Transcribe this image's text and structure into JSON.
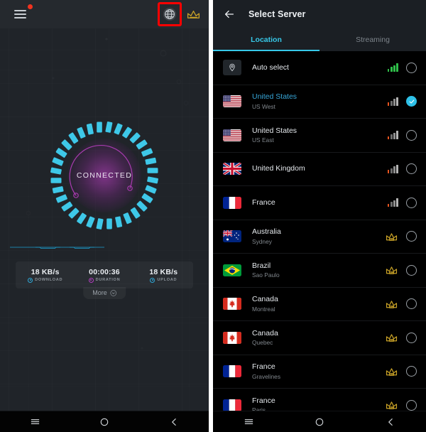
{
  "left_panel": {
    "topbar": {
      "menu_icon": "hamburger-menu-icon",
      "notification_dot": "red-dot-badge",
      "globe_icon": "globe-icon",
      "globe_highlight_color": "#ff0000",
      "crown_icon": "crown-icon"
    },
    "dial": {
      "status_label": "CONNECTED",
      "tick_color": "#3ec8e8",
      "ring_color": "#a93bb0",
      "tick_count": 32
    },
    "stats": [
      {
        "value": "18 KB/s",
        "label": "DOWNLOAD",
        "icon": "download-icon",
        "color": "#2ea8d8"
      },
      {
        "value": "00:00:36",
        "label": "DURATION",
        "icon": "clock-icon",
        "color": "#b23ec0"
      },
      {
        "value": "18 KB/s",
        "label": "UPLOAD",
        "icon": "upload-icon",
        "color": "#2ea8d8"
      }
    ],
    "more": {
      "label": "More",
      "icon": "chevron-down-circle-icon"
    },
    "navbar": [
      {
        "name": "recents-button",
        "icon": "menu-lines-icon"
      },
      {
        "name": "home-button",
        "icon": "circle-icon"
      },
      {
        "name": "back-button",
        "icon": "chevron-left-icon"
      }
    ]
  },
  "right_panel": {
    "header": {
      "back_icon": "back-arrow-icon",
      "title": "Select Server"
    },
    "tabs": [
      {
        "label": "Location",
        "active": true
      },
      {
        "label": "Streaming",
        "active": false
      }
    ],
    "accent_color": "#37c8e8",
    "servers": [
      {
        "name": "Auto select",
        "sub": "",
        "flag": "pin",
        "signal": "green4",
        "badge": "signal",
        "selected": false,
        "highlighted": false
      },
      {
        "name": "United States",
        "sub": "US West",
        "flag": "us",
        "signal": "orange1",
        "badge": "signal",
        "selected": true,
        "highlighted": true
      },
      {
        "name": "United States",
        "sub": "US East",
        "flag": "us",
        "signal": "orange1",
        "badge": "signal",
        "selected": false,
        "highlighted": false
      },
      {
        "name": "United Kingdom",
        "sub": "",
        "flag": "uk",
        "signal": "orange1",
        "badge": "signal",
        "selected": false,
        "highlighted": false
      },
      {
        "name": "France",
        "sub": "",
        "flag": "fr",
        "signal": "orange1",
        "badge": "signal",
        "selected": false,
        "highlighted": false
      },
      {
        "name": "Australia",
        "sub": "Sydney",
        "flag": "au",
        "signal": "",
        "badge": "pro",
        "selected": false,
        "highlighted": false
      },
      {
        "name": "Brazil",
        "sub": "Sao Paulo",
        "flag": "br",
        "signal": "",
        "badge": "pro",
        "selected": false,
        "highlighted": false
      },
      {
        "name": "Canada",
        "sub": "Montreal",
        "flag": "ca",
        "signal": "",
        "badge": "pro",
        "selected": false,
        "highlighted": false
      },
      {
        "name": "Canada",
        "sub": "Quebec",
        "flag": "ca",
        "signal": "",
        "badge": "pro",
        "selected": false,
        "highlighted": false
      },
      {
        "name": "France",
        "sub": "Gravelines",
        "flag": "fr",
        "signal": "",
        "badge": "pro",
        "selected": false,
        "highlighted": false
      },
      {
        "name": "France",
        "sub": "Paris",
        "flag": "fr",
        "signal": "",
        "badge": "pro",
        "selected": false,
        "highlighted": false
      }
    ],
    "pro_badge_label": "Pro",
    "navbar": [
      {
        "name": "recents-button",
        "icon": "menu-lines-icon"
      },
      {
        "name": "home-button",
        "icon": "circle-icon"
      },
      {
        "name": "back-button",
        "icon": "chevron-left-icon"
      }
    ]
  }
}
